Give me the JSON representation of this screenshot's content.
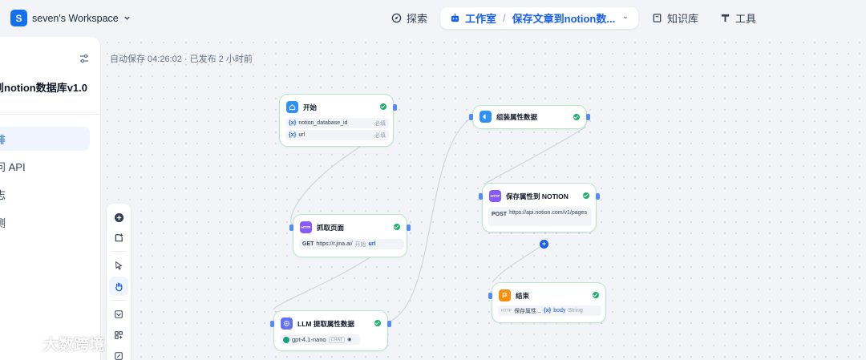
{
  "topbar": {
    "workspace_initial": "S",
    "workspace_name": "seven's Workspace",
    "explore": "探索",
    "studio": "工作室",
    "app_name": "保存文章到notion数...",
    "knowledge": "知识库",
    "tools": "工具"
  },
  "sidebar": {
    "app_title": "到notion数据库v1.0",
    "items": [
      {
        "label": "排",
        "active": true
      },
      {
        "label": "问 API",
        "active": false
      },
      {
        "label": "志",
        "active": false
      },
      {
        "label": "测",
        "active": false
      }
    ]
  },
  "canvas": {
    "autosave": "自动保存 04:26:02 · 已发布 2 小时前"
  },
  "nodes": {
    "start": {
      "title": "开始",
      "vars": [
        {
          "name": "notion_database_id",
          "tag": "必填"
        },
        {
          "name": "url",
          "tag": "必填"
        }
      ]
    },
    "fetch": {
      "title": "抓取页面",
      "method": "GET",
      "url": "https://r.jina.ai/",
      "ref_node": "开始",
      "ref_var": "url"
    },
    "llm": {
      "title": "LLM 提取属性数据",
      "model": "gpt-4.1-nano",
      "mode": "CHAT"
    },
    "assemble": {
      "title": "组装属性数据"
    },
    "save": {
      "title": "保存属性到 NOTION",
      "method": "POST",
      "url": "https://api.notion.com/v1/pages"
    },
    "end": {
      "title": "结束",
      "output_node": "保存属性...",
      "output_var": "body",
      "output_type": "String"
    }
  },
  "watermark": "大数跨境",
  "colors": {
    "accent": "#155eef",
    "success": "#17b26a",
    "node_border": "#b9e6c9",
    "start_icon": "#2e90fa",
    "http_icon": "#875bf7",
    "llm_icon": "#6172f3",
    "end_icon": "#f79009"
  }
}
